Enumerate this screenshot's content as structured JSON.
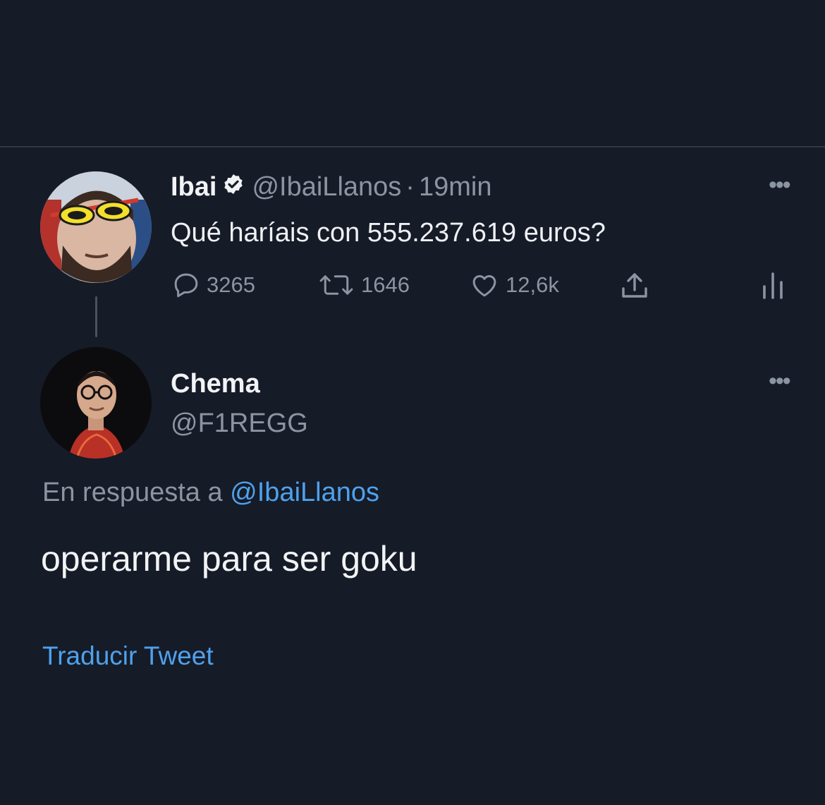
{
  "tweet": {
    "display_name": "Ibai",
    "handle": "@IbaiLlanos",
    "separator": "·",
    "time": "19min",
    "text": "Qué haríais con 555.237.619 euros?",
    "replies": "3265",
    "retweets": "1646",
    "likes": "12,6k",
    "icons": {
      "reply": "comment-icon",
      "retweet": "retweet-icon",
      "like": "heart-icon",
      "share": "share-icon",
      "analytics": "analytics-icon",
      "verified": "verified-badge-icon",
      "more": "more-dots-icon"
    }
  },
  "reply": {
    "display_name": "Chema",
    "handle": "@F1REGG",
    "in_reply_prefix": "En respuesta a",
    "in_reply_handle": "@IbaiLlanos",
    "text": "operarme para ser goku",
    "translate": "Traducir Tweet"
  },
  "colors": {
    "background": "#151b27",
    "link": "#4fa1ec",
    "muted": "#8b95a1",
    "text": "#e8eaee"
  }
}
